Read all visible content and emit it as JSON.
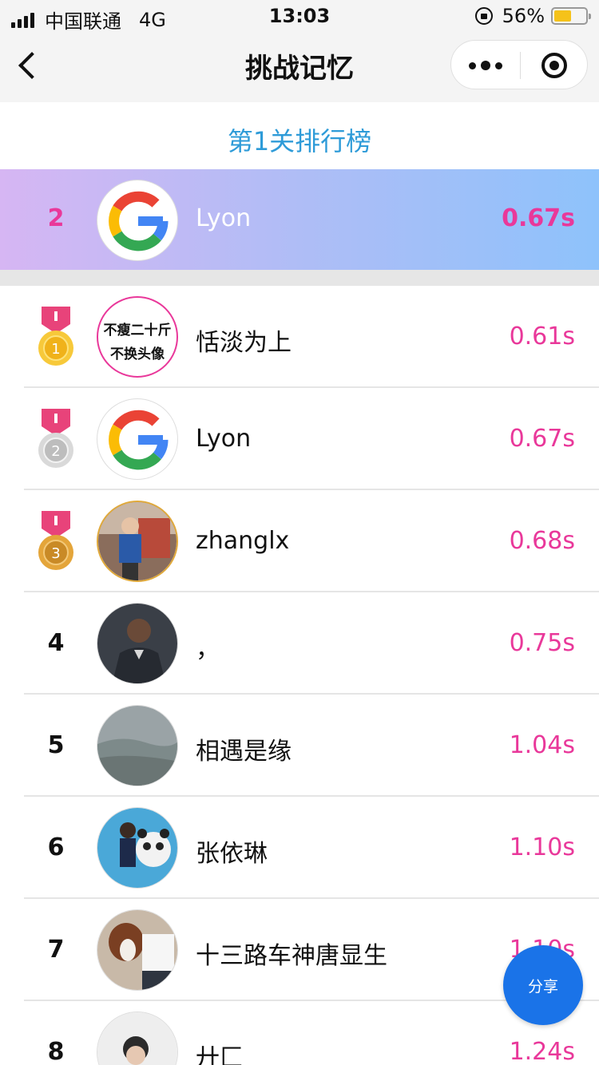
{
  "status_bar": {
    "carrier": "中国联通",
    "network": "4G",
    "time": "13:03",
    "battery": "56%"
  },
  "nav": {
    "title": "挑战记忆",
    "back_icon": "chevron-left-icon",
    "more_icon": "more-dots-icon",
    "close_icon": "target-close-icon"
  },
  "board_title": "第1关排行榜",
  "my_rank": {
    "rank": "2",
    "name": "Lyon",
    "score": "0.67s",
    "avatar": "google-logo"
  },
  "rows": [
    {
      "rank": "1",
      "name": "恬淡为上",
      "score": "0.61s",
      "avatar": "text-avatar",
      "avatar_text1": "不瘦二十斤",
      "avatar_text2": "不换头像",
      "medal": "gold"
    },
    {
      "rank": "2",
      "name": "Lyon",
      "score": "0.67s",
      "avatar": "google-logo",
      "medal": "silver"
    },
    {
      "rank": "3",
      "name": "zhanglx",
      "score": "0.68s",
      "avatar": "photo-boy",
      "medal": "bronze"
    },
    {
      "rank": "4",
      "name": "，",
      "score": "0.75s",
      "avatar": "photo-man-suit"
    },
    {
      "rank": "5",
      "name": "相遇是缘",
      "score": "1.04s",
      "avatar": "photo-landscape"
    },
    {
      "rank": "6",
      "name": "张依琳",
      "score": "1.10s",
      "avatar": "photo-girl-panda"
    },
    {
      "rank": "7",
      "name": "十三路车神唐显生",
      "score": "1.10s",
      "avatar": "photo-dog"
    },
    {
      "rank": "8",
      "name": "廾匚",
      "score": "1.24s",
      "avatar": "photo-person"
    }
  ],
  "share_label": "分享",
  "colors": {
    "accent_pink": "#e9389a",
    "title_blue": "#2e9bd8",
    "share_blue": "#1a73e8"
  }
}
